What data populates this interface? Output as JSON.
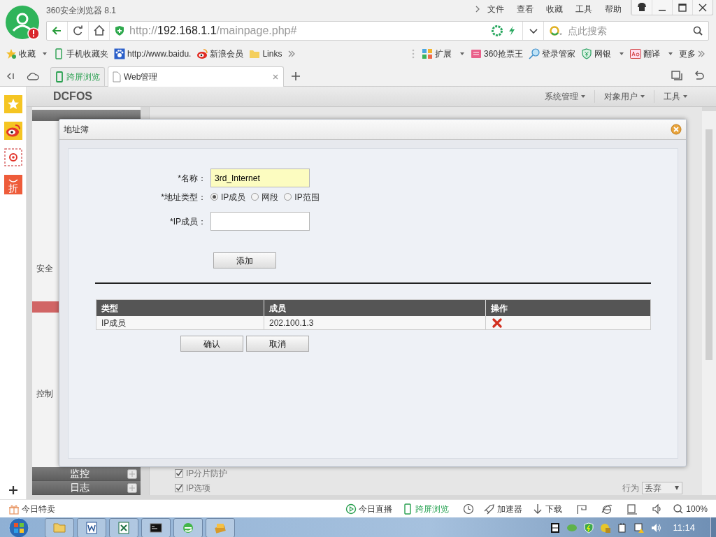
{
  "browser": {
    "title": "360安全浏览器 8.1",
    "menu": [
      "文件",
      "查看",
      "收藏",
      "工具",
      "帮助"
    ],
    "address": {
      "scheme": "http://",
      "host": "192.168.1.1",
      "path": "/mainpage.php#"
    },
    "search": {
      "placeholder": "点此搜索"
    },
    "bookmarks": [
      {
        "label": "收藏",
        "kind": "favorites"
      },
      {
        "label": "手机收藏夹",
        "kind": "phone"
      },
      {
        "label": "http://www.baidu.",
        "kind": "paw"
      },
      {
        "label": "新浪会员",
        "kind": "eye"
      },
      {
        "label": "Links",
        "kind": "folder"
      }
    ],
    "extensions": [
      {
        "label": "扩展",
        "kind": "grid",
        "dropdown": true
      },
      {
        "label": "360抢票王",
        "kind": "ticket",
        "dropdown": false
      },
      {
        "label": "登录管家",
        "kind": "key",
        "dropdown": false
      },
      {
        "label": "网银",
        "kind": "shield",
        "dropdown": true
      },
      {
        "label": "翻译",
        "kind": "translate",
        "dropdown": true
      },
      {
        "label": "更多",
        "kind": "more",
        "dropdown": false
      }
    ],
    "tabs": [
      {
        "label": "跨屏浏览",
        "kind": "cross",
        "selected": false
      },
      {
        "label": "Web管理",
        "kind": "page",
        "selected": true
      }
    ],
    "side_badge": "折"
  },
  "app": {
    "logo": "DCFOS",
    "menus": [
      "系统管理",
      "对象用户",
      "工具"
    ],
    "nav": [
      {
        "label": "安全",
        "kind": "group"
      },
      {
        "label": "控制",
        "kind": "group"
      },
      {
        "label": "监控",
        "kind": "header"
      },
      {
        "label": "日志",
        "kind": "header"
      }
    ],
    "options": [
      {
        "label": "IP分片防护",
        "checked": true
      },
      {
        "label": "IP选项",
        "checked": true
      }
    ],
    "action": {
      "label": "行为",
      "value": "丢弃"
    }
  },
  "dialog": {
    "title": "地址簿",
    "name": {
      "label": "*名称：",
      "value": "3rd_Internet"
    },
    "address_type": {
      "label": "*地址类型：",
      "options": [
        {
          "label": "IP成员",
          "selected": true
        },
        {
          "label": "网段",
          "selected": false
        },
        {
          "label": "IP范围",
          "selected": false
        }
      ]
    },
    "ip_member": {
      "label": "*IP成员："
    },
    "add_button": "添加",
    "table": {
      "columns": [
        "类型",
        "成员",
        "操作"
      ],
      "rows": [
        {
          "type": "IP成员",
          "member": "202.100.1.3"
        }
      ]
    },
    "buttons": [
      "确认",
      "取消"
    ]
  },
  "status_bar": {
    "left": "今日特卖",
    "items": [
      {
        "label": "今日直播",
        "kind": "play"
      },
      {
        "label": "跨屏浏览",
        "kind": "cross"
      },
      {
        "kind": "clock"
      },
      {
        "label": "加速器",
        "kind": "rocket"
      },
      {
        "label": "下载",
        "kind": "download"
      },
      {
        "kind": "flag"
      },
      {
        "kind": "ie"
      },
      {
        "kind": "window"
      },
      {
        "kind": "sound"
      },
      {
        "label": "100%",
        "kind": "zoom"
      }
    ]
  },
  "taskbar": {
    "clock": "11:14"
  }
}
